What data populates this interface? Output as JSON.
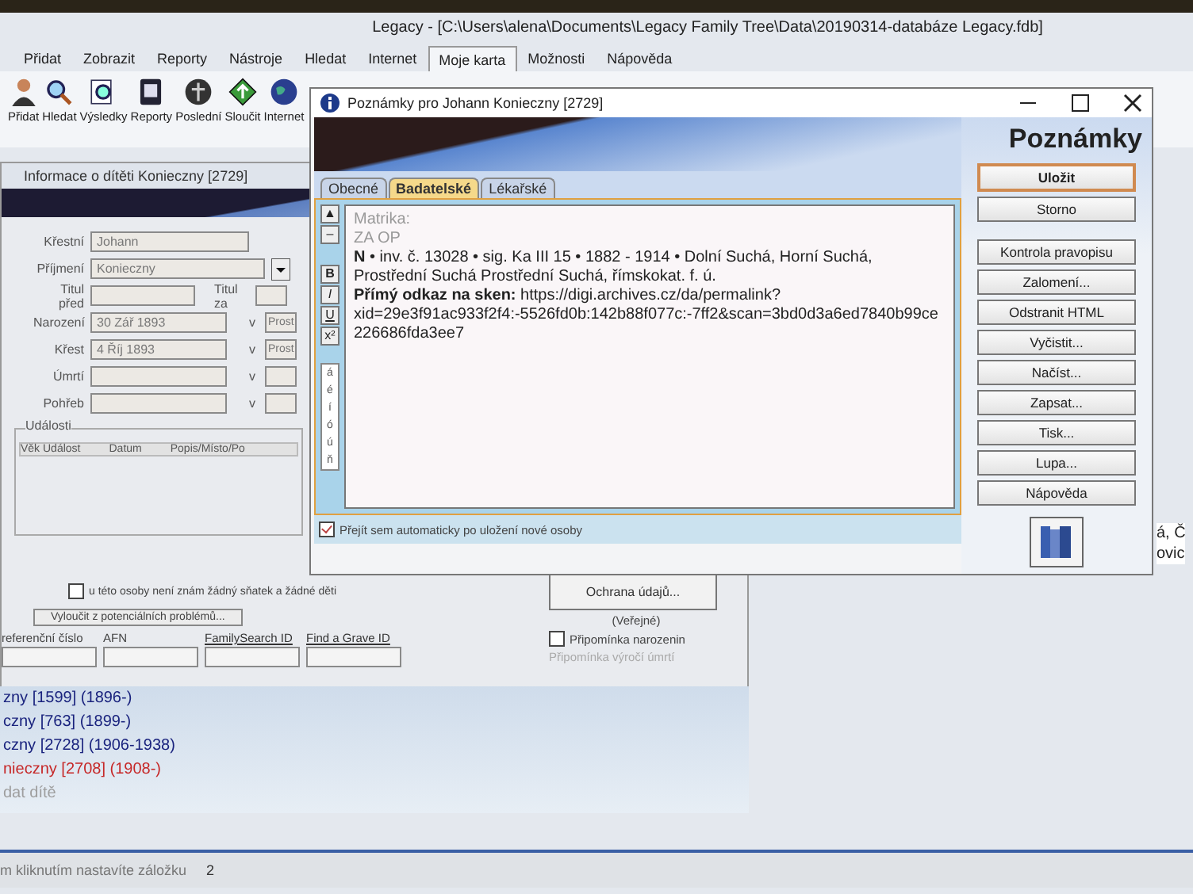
{
  "main_window": {
    "title": "Legacy - [C:\\Users\\alena\\Documents\\Legacy Family Tree\\Data\\20190314-databáze Legacy.fdb]",
    "menu": [
      {
        "label": "Přidat",
        "selected": false
      },
      {
        "label": "Zobrazit",
        "selected": false
      },
      {
        "label": "Reporty",
        "selected": false
      },
      {
        "label": "Nástroje",
        "selected": false
      },
      {
        "label": "Hledat",
        "selected": false
      },
      {
        "label": "Internet",
        "selected": false
      },
      {
        "label": "Moje karta",
        "selected": true
      },
      {
        "label": "Možnosti",
        "selected": false
      },
      {
        "label": "Nápověda",
        "selected": false
      }
    ],
    "toolbar": [
      {
        "label": "Přidat",
        "kind": "person"
      },
      {
        "label": "Hledat",
        "kind": "search"
      },
      {
        "label": "Výsledky",
        "kind": "results"
      },
      {
        "label": "Reporty",
        "kind": "report"
      },
      {
        "label": "Poslední",
        "kind": "recent"
      },
      {
        "label": "Sloučit",
        "kind": "merge"
      },
      {
        "label": "Internet",
        "kind": "globe"
      }
    ]
  },
  "child_window": {
    "title": "Informace o dítěti Konieczny [2729]",
    "fields": [
      {
        "kind": "name",
        "label": "Křestní",
        "value": "Johann"
      },
      {
        "kind": "dropdown",
        "label": "Příjmení",
        "value": "Konieczny"
      },
      {
        "kind": "title",
        "label": "Titul před",
        "value_label": "Titul za"
      },
      {
        "kind": "event",
        "label": "Narození",
        "value": "30 Zář 1893",
        "place_label": "v",
        "place": "Prost"
      },
      {
        "kind": "event",
        "label": "Křest",
        "value": "4 Říj 1893",
        "place_label": "v",
        "place": "Prost"
      },
      {
        "kind": "event",
        "label": "Úmrtí",
        "place_label": "v"
      },
      {
        "kind": "event",
        "label": "Pohřeb",
        "place_label": "v"
      }
    ],
    "events": {
      "title": "Události",
      "columns": [
        "Věk Událost",
        "Datum",
        "Popis/Místo/Po"
      ]
    },
    "no_family": {
      "label": "u této osoby není znám žádný sňatek a žádné děti",
      "checked": false
    },
    "exclude_button": "Vyloučit z potenciálních problémů...",
    "ids": [
      "referenční číslo",
      "AFN",
      "FamilySearch ID",
      "Find a Grave ID"
    ],
    "privacy_button": "Ochrana údajů...",
    "privacy_status": "(Veřejné)",
    "birthday_reminder": {
      "label": "Připomínka narozenin",
      "checked": false
    },
    "death_reminder": {
      "label": "Připomínka výročí úmrtí",
      "disabled": true
    }
  },
  "children": [
    {
      "label": "zny [1599] (1896-)",
      "color": "#1a237e"
    },
    {
      "label": "czny [763] (1899-)",
      "color": "#1a237e"
    },
    {
      "label": "czny [2728] (1906-1938)",
      "color": "#1a237e"
    },
    {
      "label": "nieczny [2708] (1908-)",
      "color": "#c62828"
    },
    {
      "label": "dat dítě",
      "color": "#9e9e9e"
    }
  ],
  "status_bar": {
    "hint": "m kliknutím nastavíte záložku",
    "count": "2"
  },
  "background_text": [
    "á, Č",
    "ovic"
  ],
  "notes_dialog": {
    "title": "Poznámky pro Johann Konieczny [2729]",
    "heading": "Poznámky",
    "tabs": [
      {
        "label": "Obecné",
        "selected": false
      },
      {
        "label": "Badatelské",
        "selected": true
      },
      {
        "label": "Lékařské",
        "selected": false
      }
    ],
    "format_buttons": [
      {
        "label": "▲",
        "kind": "arrow"
      },
      {
        "label": "–",
        "kind": "arrow"
      },
      {
        "label": "B",
        "kind": "bold"
      },
      {
        "label": "I",
        "kind": "italic"
      },
      {
        "label": "U",
        "kind": "underline"
      },
      {
        "label": "x²",
        "kind": "plain"
      }
    ],
    "characters": [
      "á",
      "é",
      "í",
      "ó",
      "ú",
      "ň"
    ],
    "note_lines": [
      {
        "kind": "label",
        "text": "Matrika:"
      },
      {
        "kind": "label",
        "text": "ZA OP"
      },
      {
        "kind": "text",
        "text": "**N** • inv. č. 13028 • sig. Ka III 15 • 1882 - 1914 • Dolní Suchá, Horní Suchá, Prostřední Suchá Prostřední Suchá, římskokat. f. ú."
      },
      {
        "kind": "text",
        "text": "**Přímý odkaz na sken:** https://digi.archives.cz/da/permalink?xid=29e3f91ac933f2f4:-5526fd0b:142b88f077c:-7ff2&scan=3bd0d3a6ed7840b99ce226686fda3ee7"
      }
    ],
    "auto_jump": {
      "label": "Přejít sem automaticky po uložení nové osoby",
      "checked": true
    },
    "buttons": [
      {
        "label": "Uložit",
        "kind": "primary"
      },
      {
        "label": "Storno",
        "kind": "normal"
      },
      {
        "label": "Kontrola pravopisu",
        "kind": "gap"
      },
      {
        "label": "Zalomení...",
        "kind": "normal"
      },
      {
        "label": "Odstranit HTML",
        "kind": "normal"
      },
      {
        "label": "Vyčistit...",
        "kind": "normal"
      },
      {
        "label": "Načíst...",
        "kind": "normal"
      },
      {
        "label": "Zapsat...",
        "kind": "normal"
      },
      {
        "label": "Tisk...",
        "kind": "normal"
      },
      {
        "label": "Lupa...",
        "kind": "normal"
      },
      {
        "label": "Nápověda",
        "kind": "normal"
      }
    ]
  }
}
